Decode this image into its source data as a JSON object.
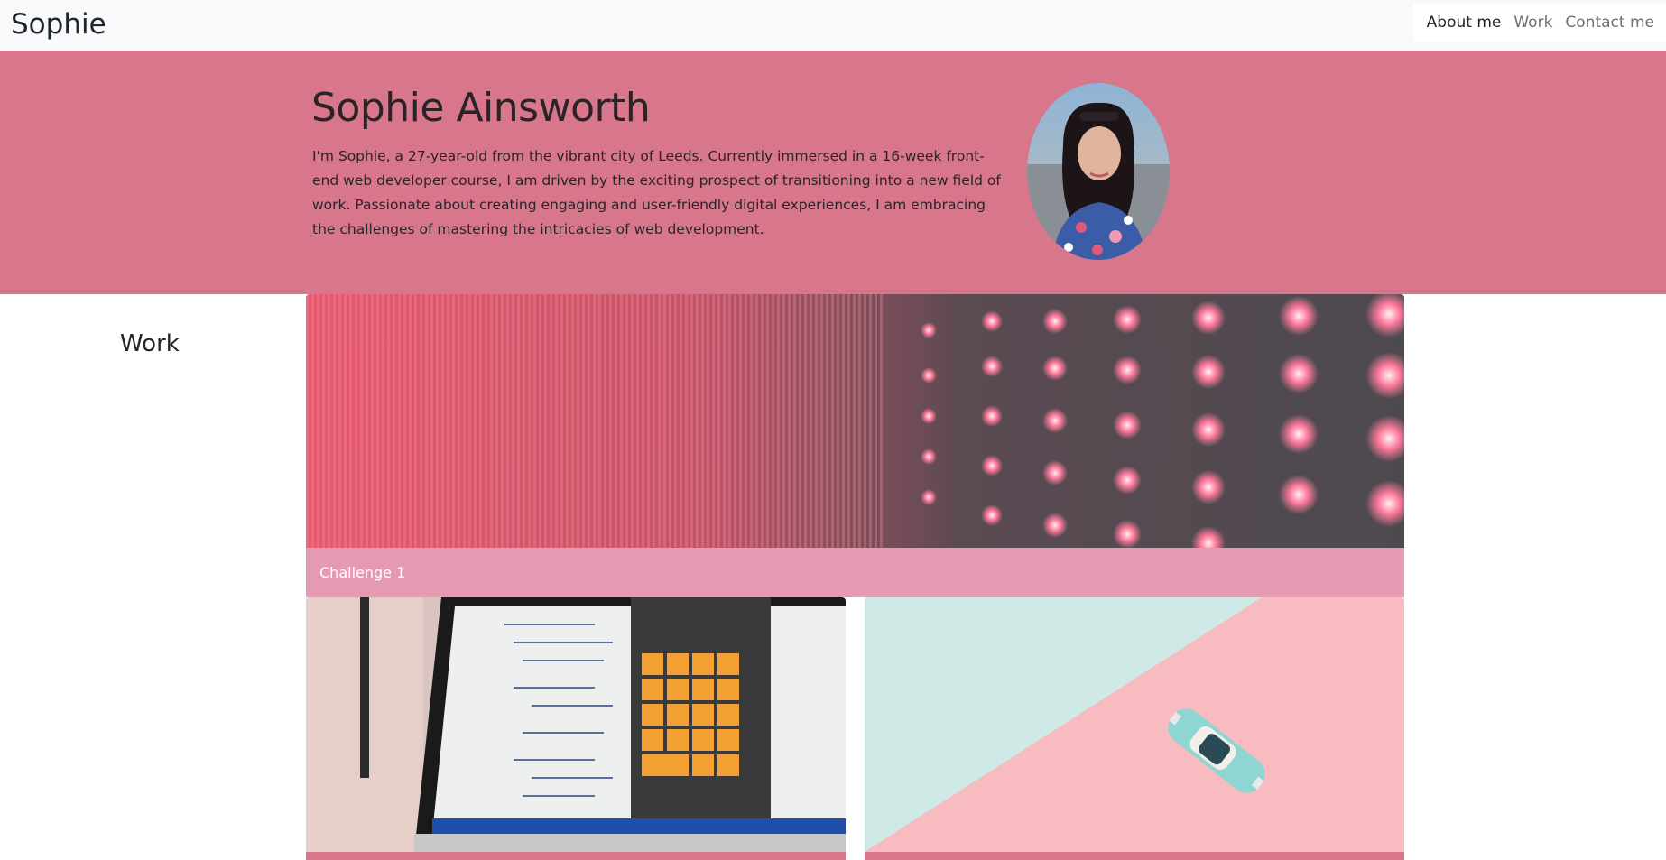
{
  "navbar": {
    "brand": "Sophie",
    "links": [
      {
        "label": "About me",
        "active": true
      },
      {
        "label": "Work",
        "active": false
      },
      {
        "label": "Contact me",
        "active": false
      }
    ]
  },
  "hero": {
    "name": "Sophie Ainsworth",
    "bio": "I'm Sophie, a 27-year-old from the vibrant city of Leeds. Currently immersed in a 16-week front-end web developer course, I am driven by the exciting prospect of transitioning into a new field of work. Passionate about creating engaging and user-friendly digital experiences, I am embracing the challenges of mastering the intricacies of web development.",
    "background_color": "#d8768c"
  },
  "work": {
    "heading": "Work",
    "cards": [
      {
        "caption": "Challenge 1",
        "image": "pink-led-lights"
      },
      {
        "caption": "",
        "image": "laptop-calculator-code"
      },
      {
        "caption": "",
        "image": "toy-car-pastel"
      }
    ]
  },
  "colors": {
    "accent": "#d8768c",
    "caption": "#e699b2",
    "navbar_bg": "#f8f9fa"
  }
}
